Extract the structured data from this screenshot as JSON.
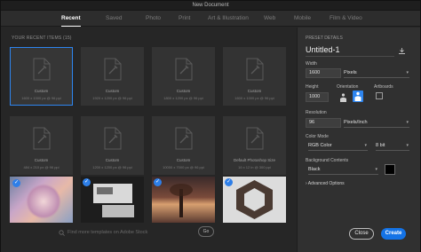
{
  "window": {
    "title": "New Document"
  },
  "tabs": [
    {
      "label": "Recent",
      "active": true
    },
    {
      "label": "Saved"
    },
    {
      "label": "Photo"
    },
    {
      "label": "Print"
    },
    {
      "label": "Art & Illustration"
    },
    {
      "label": "Web"
    },
    {
      "label": "Mobile"
    },
    {
      "label": "Film & Video"
    }
  ],
  "recent": {
    "title": "YOUR RECENT ITEMS",
    "count": "(15)",
    "items": [
      {
        "name": "Custom",
        "dims": "1600 x 1000 px @ 96 ppi"
      },
      {
        "name": "Custom",
        "dims": "1920 x 1200 px @ 96 ppi"
      },
      {
        "name": "Custom",
        "dims": "1800 x 1200 px @ 96 ppi"
      },
      {
        "name": "Custom",
        "dims": "1600 x 1000 px @ 96 ppi"
      },
      {
        "name": "Custom",
        "dims": "484 x 210 px @ 96 ppi"
      },
      {
        "name": "Custom",
        "dims": "1200 x 1200 px @ 96 ppi"
      },
      {
        "name": "Custom",
        "dims": "10000 x 7000 px @ 96 ppi"
      },
      {
        "name": "Default Photoshop Size",
        "dims": "16 x 12 in @ 300 ppi"
      }
    ]
  },
  "templates": {
    "search_placeholder": "Find more templates on Adobe Stock",
    "go_label": "Go"
  },
  "preset": {
    "header": "PRESET DETAILS",
    "name": "Untitled-1",
    "width_label": "Width",
    "width_value": "1600",
    "width_unit": "Pixels",
    "height_label": "Height",
    "height_value": "1000",
    "orientation_label": "Orientation",
    "artboards_label": "Artboards",
    "resolution_label": "Resolution",
    "resolution_value": "96",
    "resolution_unit": "Pixels/Inch",
    "color_mode_label": "Color Mode",
    "color_mode_value": "RGB Color",
    "bit_depth": "8 bit",
    "background_label": "Background Contents",
    "background_value": "Black",
    "advanced_label": "Advanced Options"
  },
  "buttons": {
    "close": "Close",
    "create": "Create"
  },
  "colors": {
    "accent": "#2e85ef",
    "create": "#1473e6",
    "panel": "#303030",
    "gallery": "#262626"
  }
}
